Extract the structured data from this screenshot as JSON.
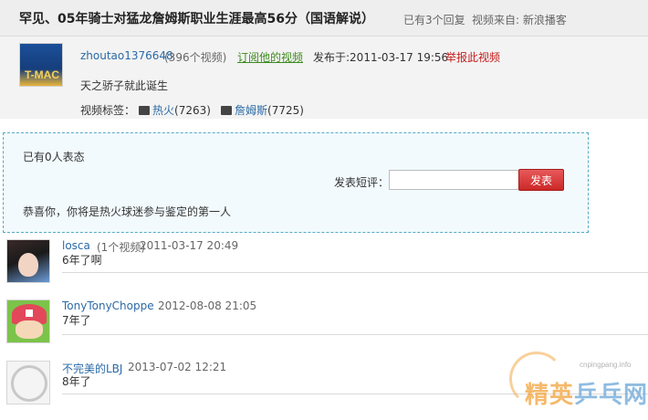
{
  "header": {
    "title": "罕见、05年骑士对猛龙詹姆斯职业生涯最高56分（国语解说）",
    "replies": "已有3个回复",
    "source": "视频来自: 新浪播客"
  },
  "uploader": {
    "avatar_text": "T-MAC",
    "username": "zhoutao1376648",
    "video_count": "(396个视频)",
    "subscribe": "订阅他的视频",
    "published": "发布于:2011-03-17 19:56",
    "report": "举报此视频",
    "description": "天之骄子就此诞生",
    "tags_label": "视频标签：",
    "tags": [
      {
        "name": "热火",
        "count": "(7263)",
        "icon": "clapperboard-icon"
      },
      {
        "name": "詹姆斯",
        "count": "(7725)",
        "icon": "clapperboard-icon"
      }
    ]
  },
  "vote": {
    "count_text": "已有0人表态",
    "comment_label": "发表短评：",
    "input_value": "",
    "submit_label": "发表",
    "congrats": "恭喜你，你将是热火球迷参与鉴定的第一人"
  },
  "comments": [
    {
      "user": "losca",
      "count": "(1个视频)",
      "date": "2011-03-17 20:49",
      "text": "6年了啊"
    },
    {
      "user": "TonyTonyChoppe",
      "count": "",
      "date": "2012-08-08 21:05",
      "text": "7年了"
    },
    {
      "user": "不完美的LBJ",
      "count": "",
      "date": "2013-07-02 12:21",
      "text": "8年了"
    }
  ],
  "watermark": {
    "url": "cnpingpang.info",
    "logo_a": "精英",
    "logo_b": "乒乓网"
  },
  "colors": {
    "link_blue": "#2b6aa6",
    "subscribe_green": "#3d8a1e",
    "report_red": "#c41c1c",
    "button_red": "#cc2828",
    "vote_border": "#57a9c6"
  }
}
